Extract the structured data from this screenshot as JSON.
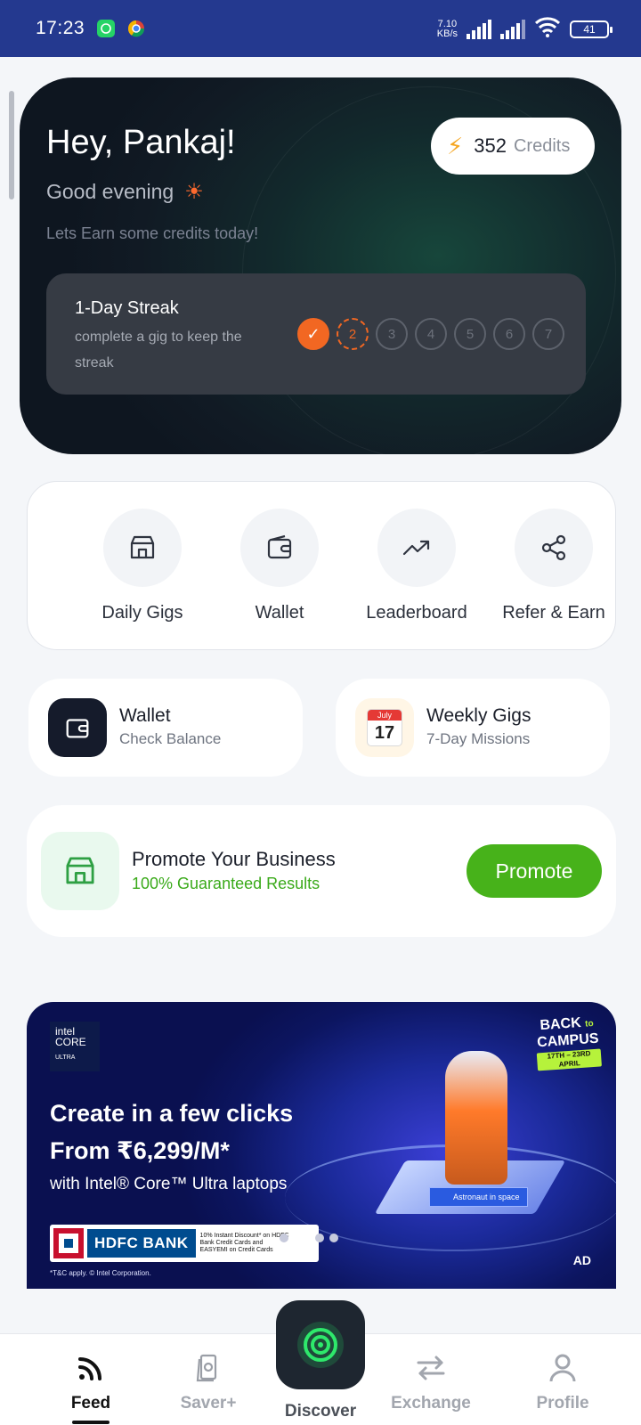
{
  "status_bar": {
    "time": "17:23",
    "net_speed_value": "7.10",
    "net_speed_unit": "KB/s",
    "battery": "41"
  },
  "hero": {
    "greeting": "Hey, Pankaj!",
    "time_of_day": "Good evening",
    "subtitle": "Lets Earn some credits today!",
    "credits_value": "352",
    "credits_label": "Credits",
    "streak": {
      "title": "1-Day Streak",
      "description": "complete a gig to keep the streak",
      "days": [
        "1",
        "2",
        "3",
        "4",
        "5",
        "6",
        "7"
      ],
      "completed_days": 1,
      "current_day": 2
    }
  },
  "quick_actions": [
    {
      "label": "Daily Gigs",
      "icon": "store-icon"
    },
    {
      "label": "Wallet",
      "icon": "wallet-icon"
    },
    {
      "label": "Leaderboard",
      "icon": "trending-up-icon"
    },
    {
      "label": "Refer & Earn",
      "icon": "share-icon"
    }
  ],
  "cards": {
    "wallet": {
      "title": "Wallet",
      "subtitle": "Check Balance",
      "icon": "wallet-icon"
    },
    "weekly": {
      "title": "Weekly Gigs",
      "subtitle": "7-Day Missions",
      "icon": "calendar-icon",
      "month": "July",
      "day": "17"
    }
  },
  "promote": {
    "title": "Promote Your Business",
    "subtitle": "100% Guaranteed Results",
    "button": "Promote",
    "accent": "#47b21a"
  },
  "ad": {
    "brand_line1": "intel",
    "brand_line2": "CORE",
    "brand_line3": "ULTRA",
    "headline1": "Create in a few clicks",
    "headline2": "From ₹6,299/M*",
    "headline3": "with Intel® Core™ Ultra laptops",
    "bank": "HDFC BANK",
    "discount": "10% Instant Discount* on HDFC Bank Credit Cards and EASYEMI on Credit Cards",
    "fine_print": "*T&C apply. © Intel Corporation.",
    "campaign_line1": "BACK",
    "campaign_to": "to",
    "campaign_line2": "CAMPUS",
    "campaign_dates": "17TH – 23RD APRIL",
    "tag": "Astronaut in space",
    "ad_label": "AD",
    "active_slide": 2,
    "slide_count": 4
  },
  "bottom_nav": {
    "feed": "Feed",
    "saver": "Saver+",
    "discover": "Discover",
    "exchange": "Exchange",
    "profile": "Profile",
    "active": "Feed"
  }
}
